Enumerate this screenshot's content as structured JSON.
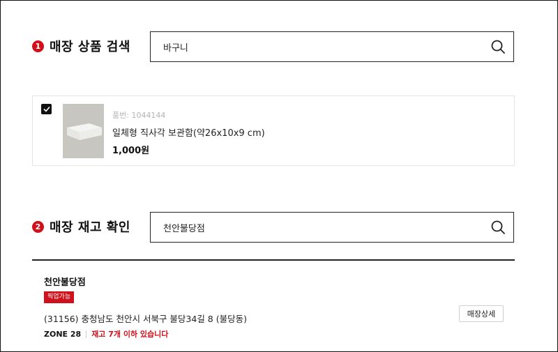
{
  "product_search": {
    "step": "1",
    "title": "매장 상품 검색",
    "query": "바구니"
  },
  "product": {
    "checked": true,
    "code": "품번: 1044144",
    "name": "일체형 직사각 보관함(약26x10x9 cm)",
    "price": "1,000원"
  },
  "stock_check": {
    "step": "2",
    "title": "매장 재고 확인",
    "query": "천안불당점"
  },
  "store": {
    "name": "천안불당점",
    "badge": "픽업가능",
    "address": "(31156) 충청남도 천안시 서북구 불당34길 8 (불당동)",
    "zone": "ZONE 28",
    "stock_text": "재고 7개 이하 있습니다",
    "detail_button": "매장상세"
  },
  "colors": {
    "accent_red": "#d0111b",
    "border_dark": "#222222"
  }
}
